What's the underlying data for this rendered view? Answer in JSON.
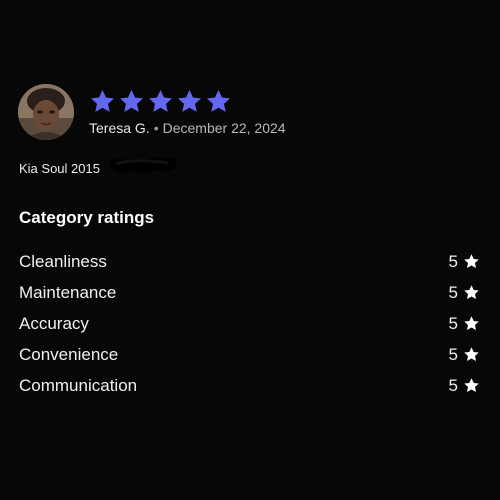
{
  "review": {
    "rating": 5,
    "max_rating": 5,
    "star_color": "#6467f0",
    "reviewer_name": "Teresa G.",
    "separator": "•",
    "date": "December 22, 2024",
    "vehicle": "Kia Soul 2015"
  },
  "avatar_icon": "profile-photo",
  "category_ratings": {
    "title": "Category ratings",
    "items": [
      {
        "label": "Cleanliness",
        "value": "5"
      },
      {
        "label": "Maintenance",
        "value": "5"
      },
      {
        "label": "Accuracy",
        "value": "5"
      },
      {
        "label": "Convenience",
        "value": "5"
      },
      {
        "label": "Communication",
        "value": "5"
      }
    ]
  }
}
